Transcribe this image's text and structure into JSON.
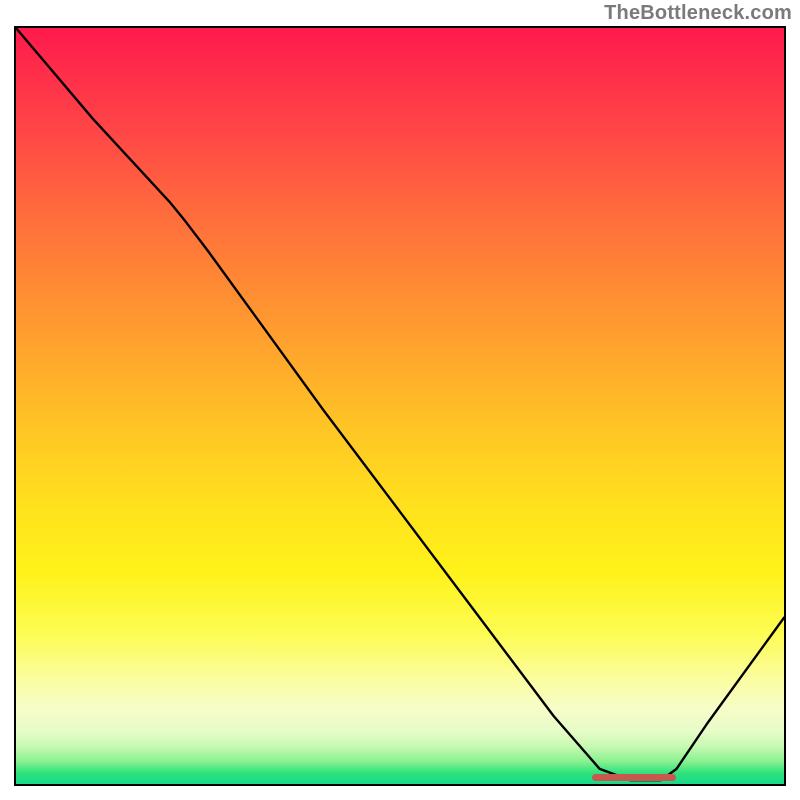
{
  "watermark": "TheBottleneck.com",
  "chart_data": {
    "type": "line",
    "title": "",
    "xlabel": "",
    "ylabel": "",
    "xlim": [
      0,
      100
    ],
    "ylim": [
      0,
      100
    ],
    "grid": false,
    "legend": false,
    "series": [
      {
        "name": "curve",
        "color": "#000000",
        "x": [
          0,
          5,
          10,
          15,
          20,
          22,
          25,
          30,
          40,
          50,
          60,
          70,
          76,
          80,
          84,
          86,
          90,
          95,
          100
        ],
        "y": [
          100,
          94,
          88,
          82.5,
          77,
          74.5,
          70.5,
          63.5,
          49.5,
          36,
          22.5,
          9,
          2,
          0.5,
          0.5,
          2,
          8,
          15,
          22
        ]
      }
    ],
    "optimal_marker": {
      "x_start": 75,
      "x_end": 86,
      "y": 0.8,
      "color": "#c8584d"
    },
    "background": "vertical-gradient red→orange→yellow→pale→green"
  }
}
